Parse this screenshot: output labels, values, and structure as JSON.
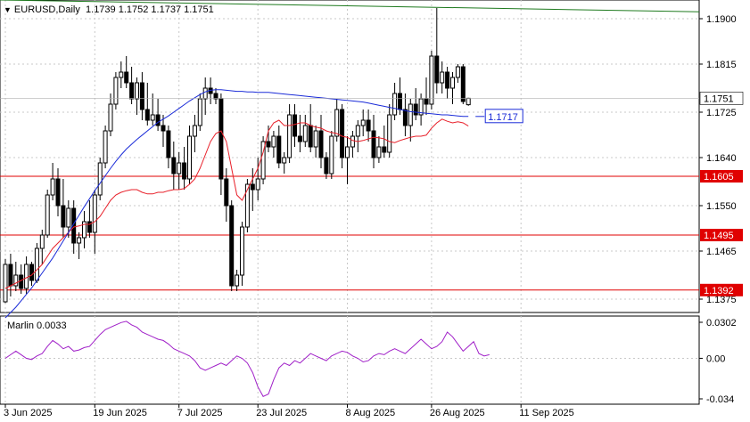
{
  "header": {
    "symbol": "EURUSD,Daily",
    "ohlc": "1.1739 1.1752 1.1737 1.1751"
  },
  "indicator": {
    "label": "Marlin 0.0033",
    "ticks": [
      "0.0302",
      "0.00",
      "-0.034"
    ]
  },
  "colors": {
    "ma_fast": "#e8202a",
    "ma_slow": "#1a2bd8",
    "trend_line": "#1e7a1e",
    "level_line": "#e00000",
    "oscillator": "#a020c8",
    "price_tag_bg": "#1a2bd8"
  },
  "chart_data": {
    "type": "candlestick",
    "title": "EURUSD,Daily",
    "y_ticks": [
      "1.1900",
      "1.1815",
      "1.1725",
      "1.1640",
      "1.1550",
      "1.1465",
      "1.1375"
    ],
    "ylim": [
      1.135,
      1.1935
    ],
    "x_ticks": [
      "3 Jun 2025",
      "19 Jun 2025",
      "7 Jul 2025",
      "23 Jul 2025",
      "8 Aug 2025",
      "26 Aug 2025",
      "11 Sep 2025"
    ],
    "last_price": "1.1751",
    "ma_label": "1.1717",
    "levels": [
      {
        "value": 1.1605,
        "label": "1.1605"
      },
      {
        "value": 1.1495,
        "label": "1.1495"
      },
      {
        "value": 1.1392,
        "label": "1.1392"
      }
    ],
    "trend_line": {
      "from": 1.1935,
      "to": 1.1913
    },
    "candles": [
      [
        1.137,
        1.145,
        1.1368,
        1.144
      ],
      [
        1.144,
        1.146,
        1.138,
        1.14
      ],
      [
        1.14,
        1.1445,
        1.139,
        1.142
      ],
      [
        1.142,
        1.144,
        1.1385,
        1.1395
      ],
      [
        1.1395,
        1.1455,
        1.1385,
        1.144
      ],
      [
        1.144,
        1.1445,
        1.14,
        1.141
      ],
      [
        1.141,
        1.148,
        1.1405,
        1.147
      ],
      [
        1.147,
        1.1505,
        1.144,
        1.1495
      ],
      [
        1.1495,
        1.158,
        1.149,
        1.157
      ],
      [
        1.157,
        1.163,
        1.156,
        1.16
      ],
      [
        1.16,
        1.162,
        1.153,
        1.155
      ],
      [
        1.155,
        1.16,
        1.149,
        1.151
      ],
      [
        1.151,
        1.156,
        1.149,
        1.1545
      ],
      [
        1.1545,
        1.156,
        1.146,
        1.148
      ],
      [
        1.148,
        1.15,
        1.145,
        1.149
      ],
      [
        1.149,
        1.154,
        1.147,
        1.152
      ],
      [
        1.152,
        1.156,
        1.149,
        1.15
      ],
      [
        1.15,
        1.158,
        1.146,
        1.157
      ],
      [
        1.157,
        1.164,
        1.156,
        1.163
      ],
      [
        1.163,
        1.17,
        1.162,
        1.169
      ],
      [
        1.169,
        1.176,
        1.168,
        1.174
      ],
      [
        1.174,
        1.18,
        1.173,
        1.179
      ],
      [
        1.179,
        1.182,
        1.177,
        1.18
      ],
      [
        1.18,
        1.183,
        1.177,
        1.178
      ],
      [
        1.178,
        1.181,
        1.174,
        1.175
      ],
      [
        1.175,
        1.179,
        1.172,
        1.178
      ],
      [
        1.178,
        1.18,
        1.171,
        1.173
      ],
      [
        1.173,
        1.178,
        1.17,
        1.171
      ],
      [
        1.171,
        1.176,
        1.17,
        1.172
      ],
      [
        1.172,
        1.175,
        1.169,
        1.17
      ],
      [
        1.17,
        1.172,
        1.166,
        1.169
      ],
      [
        1.169,
        1.17,
        1.162,
        1.164
      ],
      [
        1.164,
        1.167,
        1.158,
        1.161
      ],
      [
        1.161,
        1.165,
        1.158,
        1.163
      ],
      [
        1.163,
        1.166,
        1.158,
        1.16
      ],
      [
        1.16,
        1.17,
        1.159,
        1.168
      ],
      [
        1.168,
        1.172,
        1.165,
        1.17
      ],
      [
        1.17,
        1.176,
        1.169,
        1.175
      ],
      [
        1.175,
        1.179,
        1.172,
        1.177
      ],
      [
        1.177,
        1.179,
        1.174,
        1.176
      ],
      [
        1.176,
        1.177,
        1.174,
        1.175
      ],
      [
        1.175,
        1.176,
        1.157,
        1.16
      ],
      [
        1.16,
        1.162,
        1.152,
        1.155
      ],
      [
        1.155,
        1.156,
        1.139,
        1.14
      ],
      [
        1.14,
        1.143,
        1.139,
        1.142
      ],
      [
        1.142,
        1.152,
        1.14,
        1.151
      ],
      [
        1.151,
        1.16,
        1.15,
        1.159
      ],
      [
        1.159,
        1.162,
        1.154,
        1.158
      ],
      [
        1.158,
        1.164,
        1.156,
        1.16
      ],
      [
        1.16,
        1.168,
        1.159,
        1.167
      ],
      [
        1.167,
        1.17,
        1.165,
        1.166
      ],
      [
        1.166,
        1.169,
        1.164,
        1.168
      ],
      [
        1.168,
        1.17,
        1.162,
        1.163
      ],
      [
        1.163,
        1.165,
        1.161,
        1.164
      ],
      [
        1.164,
        1.174,
        1.163,
        1.172
      ],
      [
        1.172,
        1.174,
        1.166,
        1.168
      ],
      [
        1.168,
        1.172,
        1.165,
        1.167
      ],
      [
        1.167,
        1.172,
        1.166,
        1.17
      ],
      [
        1.17,
        1.174,
        1.165,
        1.166
      ],
      [
        1.166,
        1.17,
        1.164,
        1.169
      ],
      [
        1.169,
        1.172,
        1.162,
        1.164
      ],
      [
        1.164,
        1.165,
        1.16,
        1.161
      ],
      [
        1.161,
        1.169,
        1.16,
        1.168
      ],
      [
        1.168,
        1.175,
        1.167,
        1.173
      ],
      [
        1.173,
        1.174,
        1.162,
        1.164
      ],
      [
        1.164,
        1.168,
        1.159,
        1.166
      ],
      [
        1.166,
        1.169,
        1.164,
        1.168
      ],
      [
        1.168,
        1.171,
        1.165,
        1.17
      ],
      [
        1.17,
        1.173,
        1.168,
        1.171
      ],
      [
        1.171,
        1.173,
        1.167,
        1.169
      ],
      [
        1.169,
        1.172,
        1.162,
        1.164
      ],
      [
        1.164,
        1.168,
        1.163,
        1.166
      ],
      [
        1.166,
        1.17,
        1.164,
        1.165
      ],
      [
        1.165,
        1.174,
        1.164,
        1.172
      ],
      [
        1.172,
        1.178,
        1.171,
        1.176
      ],
      [
        1.176,
        1.179,
        1.172,
        1.173
      ],
      [
        1.173,
        1.176,
        1.168,
        1.17
      ],
      [
        1.17,
        1.175,
        1.167,
        1.174
      ],
      [
        1.174,
        1.177,
        1.171,
        1.172
      ],
      [
        1.172,
        1.176,
        1.17,
        1.175
      ],
      [
        1.175,
        1.179,
        1.172,
        1.174
      ],
      [
        1.174,
        1.184,
        1.173,
        1.183
      ],
      [
        1.183,
        1.192,
        1.176,
        1.178
      ],
      [
        1.178,
        1.182,
        1.176,
        1.18
      ],
      [
        1.18,
        1.181,
        1.175,
        1.177
      ],
      [
        1.177,
        1.18,
        1.174,
        1.179
      ],
      [
        1.179,
        1.1815,
        1.178,
        1.181
      ],
      [
        1.181,
        1.1815,
        1.174,
        1.1745
      ],
      [
        1.1739,
        1.1752,
        1.1737,
        1.1751
      ]
    ],
    "ma_fast_values": [
      1.1395,
      1.14,
      1.1405,
      1.141,
      1.1415,
      1.142,
      1.143,
      1.144,
      1.1455,
      1.147,
      1.148,
      1.149,
      1.15,
      1.151,
      1.1512,
      1.1515,
      1.1515,
      1.152,
      1.153,
      1.1545,
      1.156,
      1.157,
      1.1575,
      1.1578,
      1.158,
      1.158,
      1.1575,
      1.1572,
      1.1572,
      1.1575,
      1.1575,
      1.1578,
      1.158,
      1.158,
      1.1582,
      1.159,
      1.16,
      1.162,
      1.1645,
      1.167,
      1.1685,
      1.169,
      1.167,
      1.162,
      1.157,
      1.156,
      1.158,
      1.16,
      1.162,
      1.165,
      1.169,
      1.1705,
      1.171,
      1.17,
      1.17,
      1.1702,
      1.1705,
      1.1705,
      1.17,
      1.1697,
      1.1695,
      1.169,
      1.1687,
      1.1685,
      1.168,
      1.1678,
      1.1672,
      1.167,
      1.1672,
      1.1675,
      1.1678,
      1.1677,
      1.1675,
      1.167,
      1.1668,
      1.1672,
      1.1675,
      1.1678,
      1.168,
      1.168,
      1.1682,
      1.1695,
      1.1705,
      1.1712,
      1.1708,
      1.1705,
      1.1707,
      1.1705,
      1.1699
    ],
    "ma_slow_values": [
      1.134,
      1.135,
      1.136,
      1.1372,
      1.1384,
      1.1396,
      1.141,
      1.1424,
      1.1438,
      1.1452,
      1.1468,
      1.1484,
      1.15,
      1.1516,
      1.1532,
      1.1548,
      1.1563,
      1.1578,
      1.1592,
      1.1606,
      1.162,
      1.1633,
      1.1645,
      1.1656,
      1.1665,
      1.1674,
      1.1682,
      1.169,
      1.1698,
      1.1706,
      1.1712,
      1.1718,
      1.1725,
      1.1732,
      1.1739,
      1.1746,
      1.1752,
      1.1758,
      1.1763,
      1.1766,
      1.1767,
      1.1767,
      1.1766,
      1.1765,
      1.1764,
      1.1764,
      1.1763,
      1.1763,
      1.1762,
      1.1762,
      1.1762,
      1.1761,
      1.176,
      1.1759,
      1.1758,
      1.1757,
      1.1756,
      1.1755,
      1.1754,
      1.1753,
      1.1752,
      1.1751,
      1.175,
      1.1749,
      1.1748,
      1.1747,
      1.1746,
      1.1745,
      1.1744,
      1.1742,
      1.174,
      1.1738,
      1.1736,
      1.1734,
      1.1732,
      1.173,
      1.1728,
      1.1726,
      1.1725,
      1.1724,
      1.1723,
      1.1722,
      1.1721,
      1.172,
      1.172,
      1.1719,
      1.1718,
      1.1717,
      1.1717
    ],
    "oscillator": {
      "ylim": [
        -0.034,
        0.0302
      ],
      "values": [
        0.0,
        0.003,
        0.006,
        0.003,
        0.0,
        -0.001,
        0.002,
        0.004,
        0.01,
        0.015,
        0.012,
        0.008,
        0.01,
        0.006,
        0.007,
        0.009,
        0.01,
        0.015,
        0.02,
        0.024,
        0.026,
        0.028,
        0.03,
        0.031,
        0.028,
        0.026,
        0.022,
        0.02,
        0.018,
        0.016,
        0.015,
        0.012,
        0.008,
        0.006,
        0.004,
        0.002,
        -0.002,
        -0.008,
        -0.01,
        -0.008,
        -0.006,
        -0.004,
        -0.006,
        -0.002,
        0.002,
        0.0,
        -0.004,
        -0.012,
        -0.024,
        -0.032,
        -0.03,
        -0.018,
        -0.008,
        -0.004,
        -0.006,
        -0.002,
        -0.004,
        0.0,
        0.004,
        0.002,
        0.0,
        -0.002,
        0.002,
        0.004,
        0.006,
        0.005,
        0.002,
        0.0,
        -0.003,
        -0.002,
        0.002,
        0.004,
        0.003,
        0.006,
        0.008,
        0.006,
        0.004,
        0.008,
        0.012,
        0.016,
        0.012,
        0.008,
        0.01,
        0.014,
        0.022,
        0.018,
        0.012,
        0.006,
        0.01,
        0.014,
        0.004,
        0.002,
        0.003
      ]
    }
  }
}
